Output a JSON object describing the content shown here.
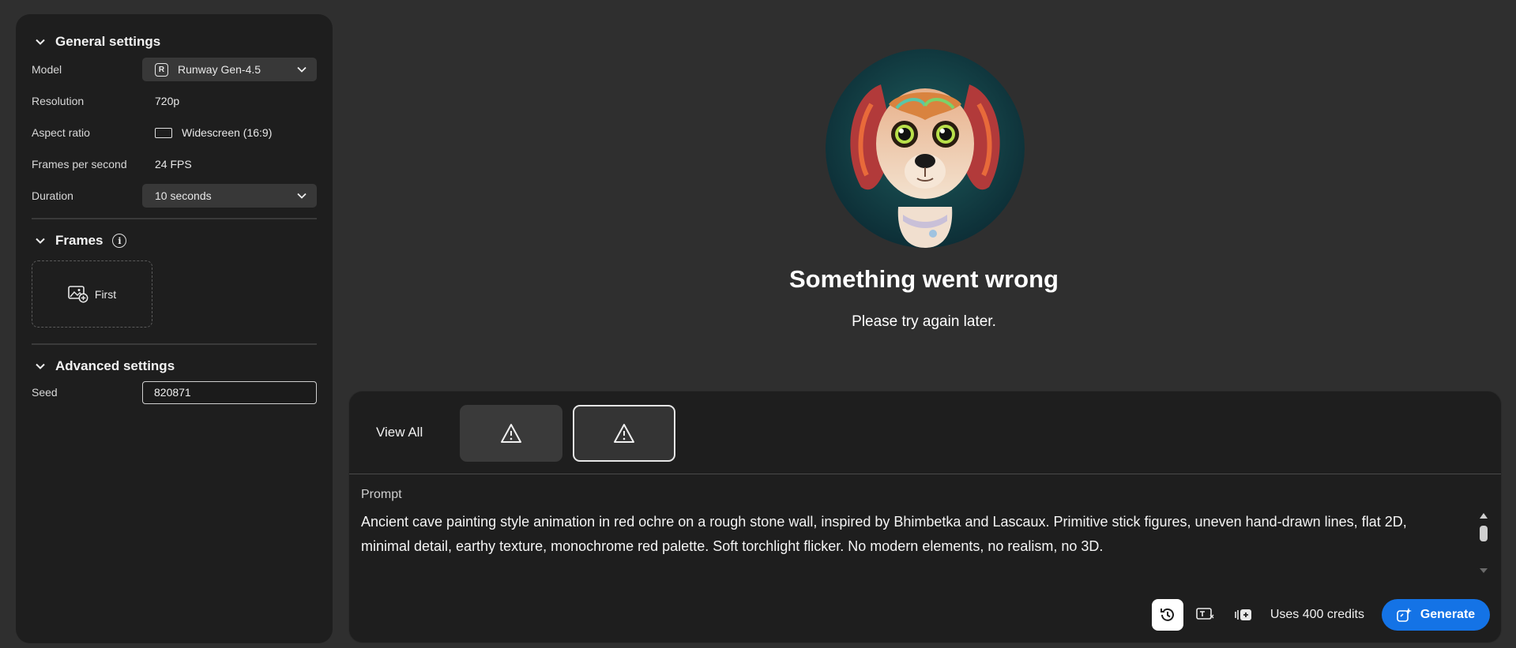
{
  "general_settings": {
    "title": "General settings",
    "model": {
      "label": "Model",
      "value": "Runway Gen-4.5",
      "logo_glyph": "R"
    },
    "resolution": {
      "label": "Resolution",
      "value": "720p"
    },
    "aspect_ratio": {
      "label": "Aspect ratio",
      "value": "Widescreen (16:9)"
    },
    "fps": {
      "label": "Frames per second",
      "value": "24 FPS"
    },
    "duration": {
      "label": "Duration",
      "value": "10 seconds"
    }
  },
  "frames": {
    "title": "Frames",
    "info_glyph": "i",
    "first_label": "First"
  },
  "advanced_settings": {
    "title": "Advanced settings",
    "seed": {
      "label": "Seed",
      "value": "820871"
    }
  },
  "error": {
    "title": "Something went wrong",
    "message": "Please try again later."
  },
  "history": {
    "view_all_label": "View All",
    "thumbnails": [
      {
        "state": "warning",
        "selected": false
      },
      {
        "state": "warning",
        "selected": true
      }
    ]
  },
  "prompt": {
    "label": "Prompt",
    "text": "Ancient cave painting style animation in red ochre on a rough stone wall, inspired by Bhimbetka and Lascaux. Primitive stick figures, uneven hand-drawn lines, flat 2D, minimal detail, earthy texture, monochrome red palette. Soft torchlight flicker. No modern elements, no realism, no 3D."
  },
  "footer": {
    "credits_label": "Uses 400 credits",
    "generate_label": "Generate",
    "icons": [
      "history-icon",
      "text-effects-icon",
      "video-settings-icon"
    ]
  },
  "colors": {
    "background": "#2f2f2f",
    "panel": "#1e1e1e",
    "accent": "#1473e6"
  }
}
